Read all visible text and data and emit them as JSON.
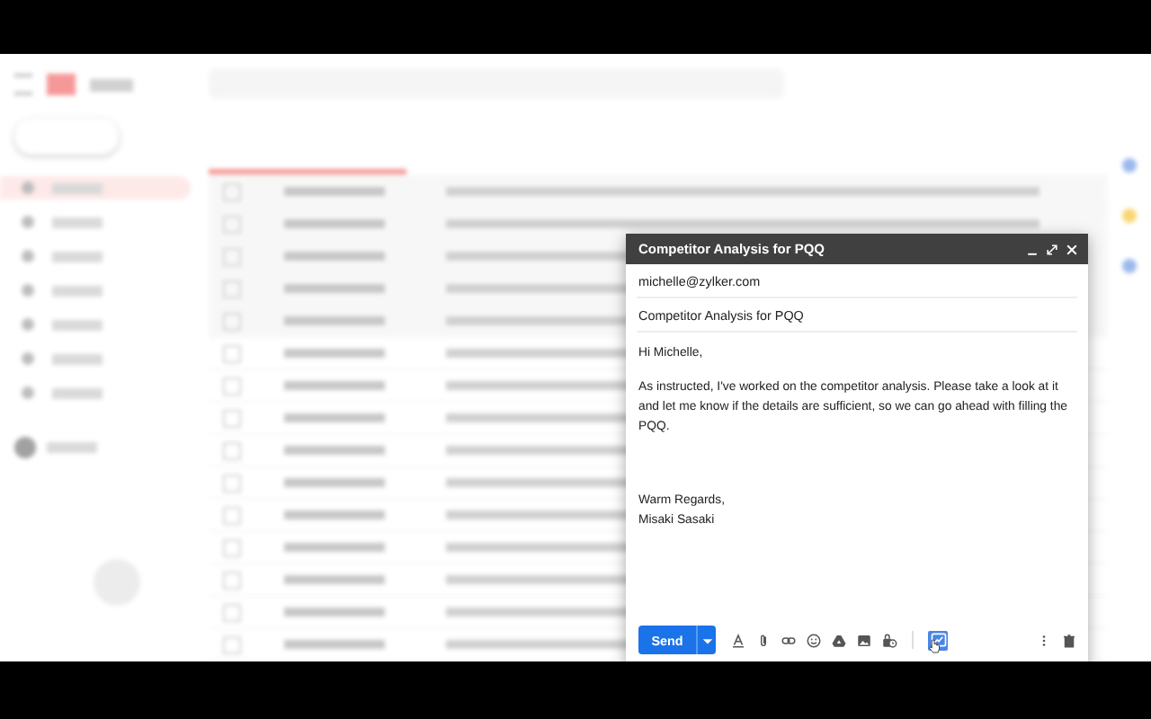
{
  "compose": {
    "title": "Competitor Analysis for PQQ",
    "to": "michelle@zylker.com",
    "subject": "Competitor Analysis for PQQ",
    "body": [
      "Hi Michelle,",
      "As instructed, I've worked on the competitor analysis. Please take a look at it and let me know if the details are sufficient, so we can go ahead with filling the PQQ."
    ],
    "signature": [
      "Warm Regards,",
      "Misaki Sasaki"
    ],
    "send": "Send"
  }
}
